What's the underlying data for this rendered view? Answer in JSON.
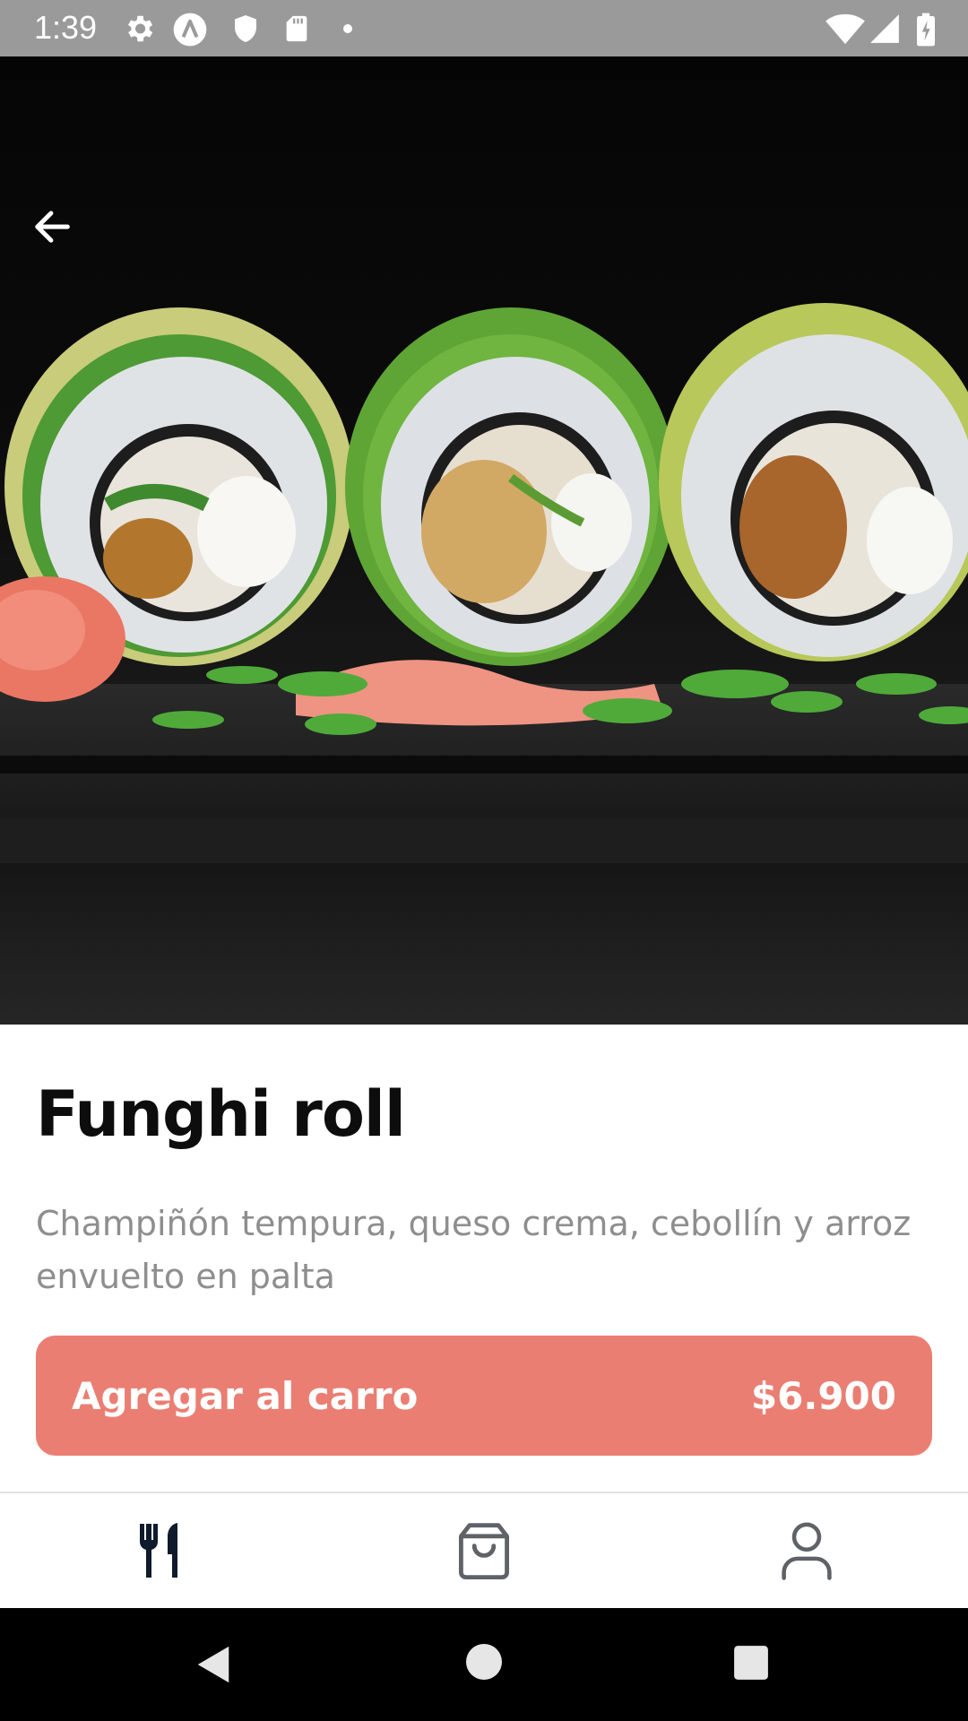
{
  "status_bar": {
    "time": "1:39",
    "left_icons": [
      "gear-icon",
      "a-circle-icon",
      "shield-icon",
      "sd-card-icon",
      "dot-icon"
    ],
    "right_icons": [
      "wifi-icon",
      "signal-icon",
      "battery-charging-icon"
    ]
  },
  "hero": {
    "back_icon": "arrow-left-icon"
  },
  "product": {
    "name": "Funghi roll",
    "description": "Champiñón tempura, queso crema, cebollín y arroz envuelto en palta"
  },
  "cart_button": {
    "label": "Agregar al carro",
    "price": "$6.900",
    "color": "#eb7e72"
  },
  "bottom_nav": {
    "items": [
      {
        "icon": "fork-knife-icon",
        "active": true
      },
      {
        "icon": "shopping-bag-icon",
        "active": false
      },
      {
        "icon": "user-icon",
        "active": false
      }
    ],
    "active_color": "#0f1b2d",
    "inactive_color": "#5f6368"
  },
  "system_nav": {
    "buttons": [
      "back-triangle-icon",
      "home-circle-icon",
      "recents-square-icon"
    ]
  }
}
